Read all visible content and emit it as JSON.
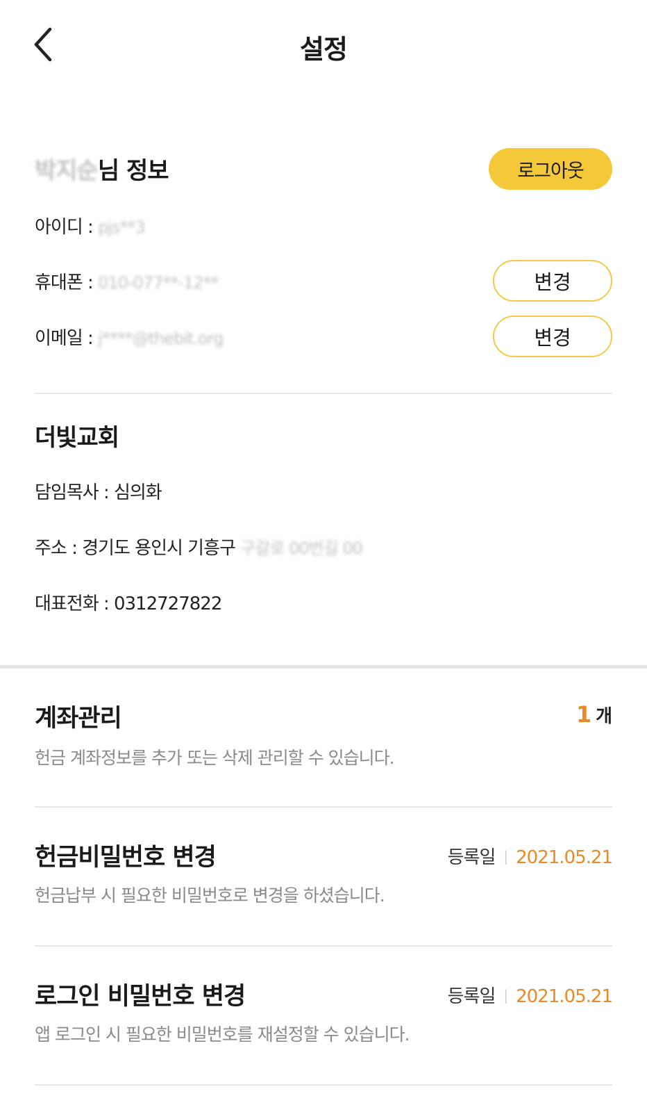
{
  "header": {
    "title": "설정",
    "back_icon": "chevron-left-icon"
  },
  "user_info": {
    "name_masked": "박지순",
    "title_suffix": "님 정보",
    "logout_label": "로그아웃",
    "id_label": "아이디 : ",
    "id_value_masked": "pjs**3",
    "phone_label": "휴대폰 : ",
    "phone_value_masked": "010-077**-12**",
    "phone_change_label": "변경",
    "email_label": "이메일 : ",
    "email_value_masked": "j****@thebit.org",
    "email_change_label": "변경"
  },
  "church": {
    "name": "더빛교회",
    "pastor": "담임목사 : 심의화",
    "address_prefix": "주소 : 경기도 용인시 기흥구 ",
    "address_masked": "구갈로 00번길 00",
    "phone": "대표전화 : 0312727822"
  },
  "account_manage": {
    "title": "계좌관리",
    "count": "1",
    "count_unit": "개",
    "description": "헌금 계좌정보를 추가 또는 삭제 관리할 수 있습니다."
  },
  "offering_password": {
    "title": "헌금비밀번호 변경",
    "reg_label": "등록일",
    "reg_date": "2021.05.21",
    "description": "헌금납부 시 필요한 비밀번호로 변경을 하셨습니다."
  },
  "login_password": {
    "title": "로그인 비밀번호 변경",
    "reg_label": "등록일",
    "reg_date": "2021.05.21",
    "description": "앱 로그인 시 필요한 비밀번호를 재설정할 수 있습니다."
  },
  "colors": {
    "accent_yellow": "#f5c83a",
    "accent_orange": "#e8892a",
    "divider": "#e8e8e8"
  }
}
